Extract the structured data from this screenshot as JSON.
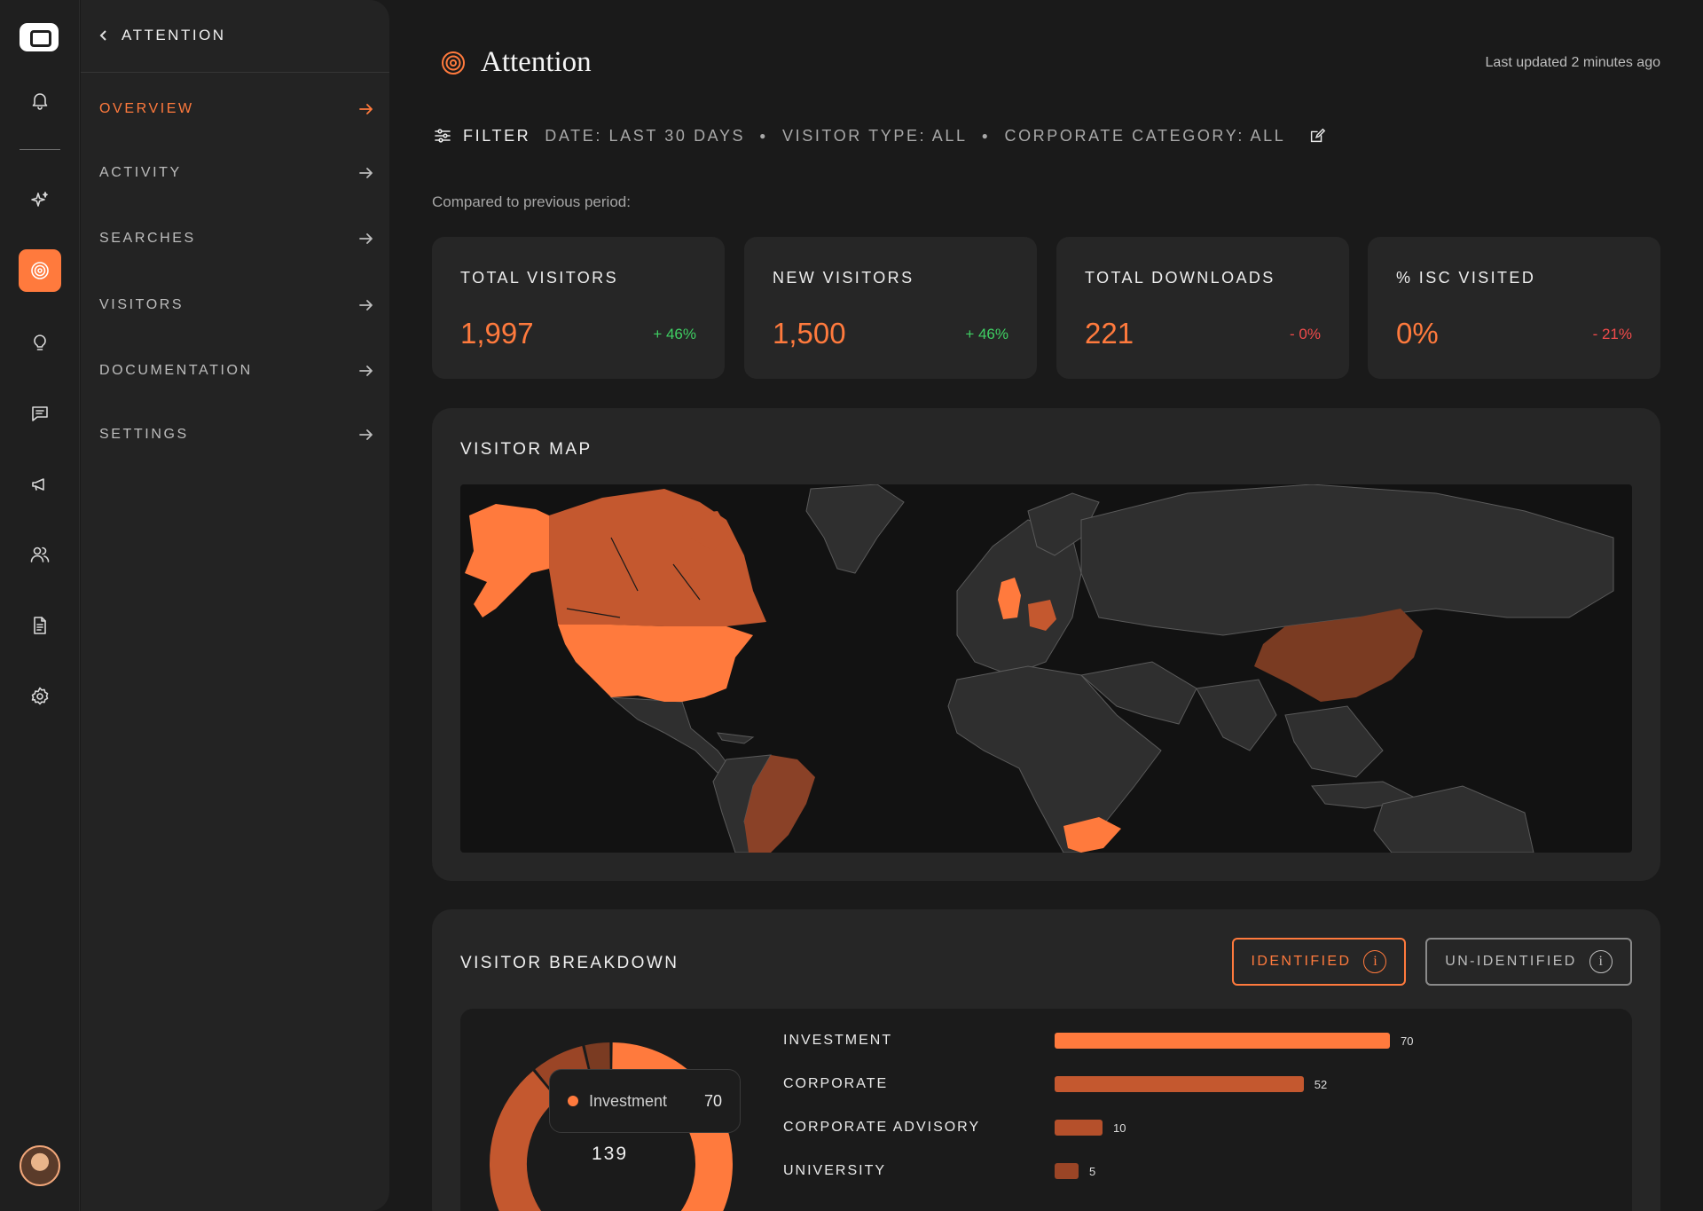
{
  "rail": {
    "icons": [
      "bell-icon",
      "sparkle-icon",
      "target-icon",
      "lightbulb-icon",
      "message-icon",
      "megaphone-icon",
      "users-icon",
      "document-icon",
      "gear-icon"
    ],
    "active": "target-icon"
  },
  "subnav": {
    "back_label": "ATTENTION",
    "items": [
      {
        "label": "OVERVIEW",
        "active": true
      },
      {
        "label": "ACTIVITY",
        "active": false
      },
      {
        "label": "SEARCHES",
        "active": false
      },
      {
        "label": "VISITORS",
        "active": false
      },
      {
        "label": "DOCUMENTATION",
        "active": false
      },
      {
        "label": "SETTINGS",
        "active": false
      }
    ]
  },
  "header": {
    "title": "Attention",
    "updated": "Last updated 2 minutes ago"
  },
  "filter": {
    "label": "FILTER",
    "date": "DATE: LAST 30 DAYS",
    "visitor_type": "VISITOR TYPE: ALL",
    "corporate_category": "CORPORATE CATEGORY: ALL"
  },
  "compared": "Compared to previous period:",
  "stats": [
    {
      "label": "TOTAL VISITORS",
      "value": "1,997",
      "change": "+ 46%",
      "trend": "up"
    },
    {
      "label": "NEW VISITORS",
      "value": "1,500",
      "change": "+ 46%",
      "trend": "up"
    },
    {
      "label": "TOTAL DOWNLOADS",
      "value": "221",
      "change": "- 0%",
      "trend": "down"
    },
    {
      "label": "% ISC VISITED",
      "value": "0%",
      "change": "- 21%",
      "trend": "down"
    }
  ],
  "visitor_map": {
    "title": "VISITOR MAP"
  },
  "breakdown": {
    "title": "VISITOR BREAKDOWN",
    "toggle_identified": "IDENTIFIED",
    "toggle_unidentified": "UN-IDENTIFIED",
    "info_glyph": "i",
    "tooltip_label": "Investment",
    "tooltip_value": "70",
    "total": "139"
  },
  "colors": {
    "accent": "#ff7a3d",
    "accent_mid": "#c4582f",
    "accent_dark": "#7a3b22",
    "positive": "#3fcf63",
    "negative": "#f14b4b"
  },
  "chart_data": {
    "type": "bar",
    "categories": [
      "INVESTMENT",
      "CORPORATE",
      "CORPORATE ADVISORY",
      "UNIVERSITY"
    ],
    "values": [
      70,
      52,
      10,
      5
    ],
    "total": 139,
    "xlim": [
      0,
      70
    ]
  }
}
